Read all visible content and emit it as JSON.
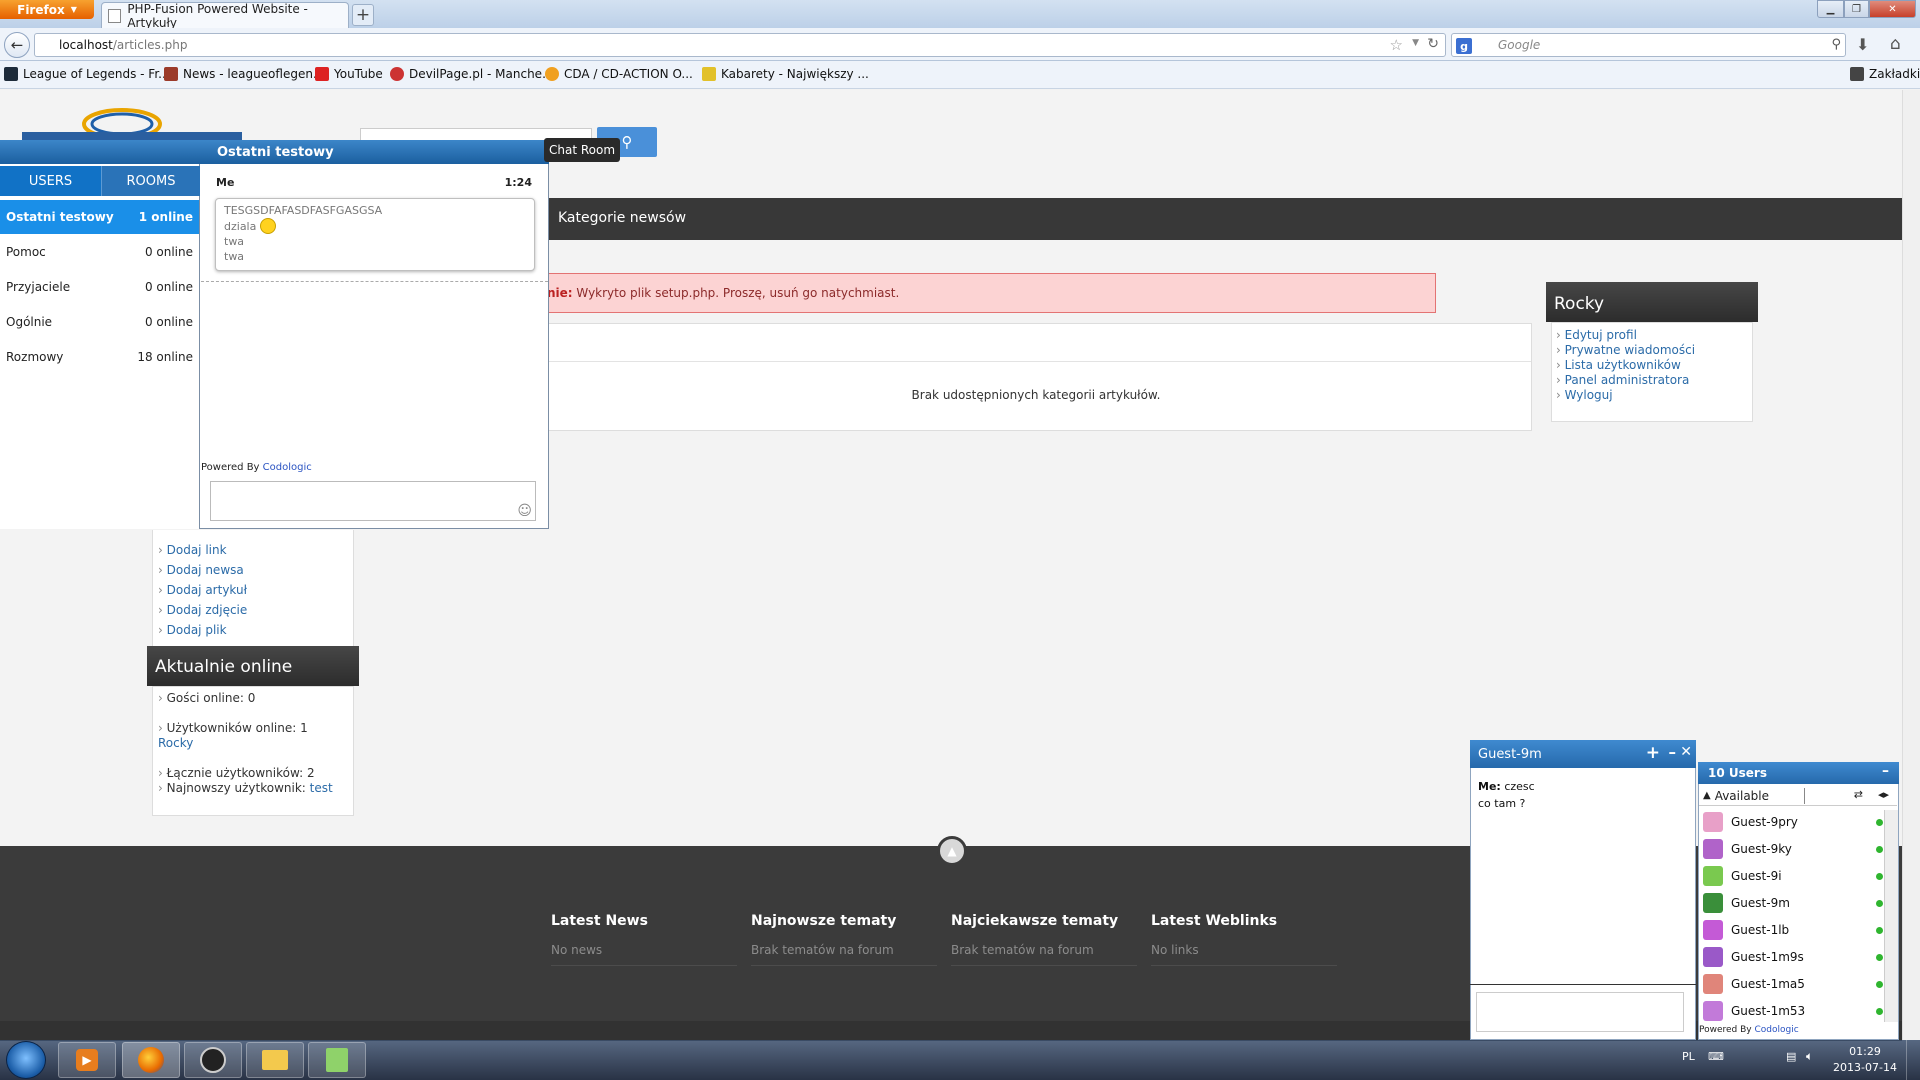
{
  "browser": {
    "app_button": "Firefox",
    "tab_title": "PHP-Fusion Powered Website - Artykuły",
    "url_host": "localhost",
    "url_path": "/articles.php",
    "search_placeholder": "Google",
    "bookmarks": [
      "League of Legends - Fr...",
      "News - leagueoflegen...",
      "YouTube",
      "DevilPage.pl - Manche...",
      "CDA / CD-ACTION O...",
      "Kabarety - Największy ..."
    ],
    "bookmarks_menu": "Zakładki"
  },
  "page": {
    "nav_label": "Kategorie newsów",
    "alert_prefix": "nie:",
    "alert_text": "Wykryto plik setup.php. Proszę, usuń go natychmiast.",
    "content_message": "Brak udostępnionych kategorii artykułów.",
    "user_panel": {
      "title": "Rocky",
      "links": [
        "Edytuj profil",
        "Prywatne wiadomości",
        "Lista użytkowników",
        "Panel administratora",
        "Wyloguj"
      ]
    },
    "submit_links": [
      "Dodaj link",
      "Dodaj newsa",
      "Dodaj artykuł",
      "Dodaj zdjęcie",
      "Dodaj plik"
    ],
    "online_panel": {
      "title": "Aktualnie online",
      "guests": "Gości online: 0",
      "users": "Użytkowników online: 1",
      "user_name": "Rocky",
      "total": "Łącznie użytkowników: 2",
      "newest_label": "Najnowszy użytkownik:",
      "newest_name": "test"
    },
    "footer": [
      {
        "title": "Latest News",
        "value": "No news"
      },
      {
        "title": "Najnowsze tematy",
        "value": "Brak tematów na forum"
      },
      {
        "title": "Najciekawsze tematy",
        "value": "Brak tematów na forum"
      },
      {
        "title": "Latest Weblinks",
        "value": "No links"
      }
    ]
  },
  "chat": {
    "title": "Ostatni testowy",
    "room_tab": "Chat Room",
    "tab_users": "USERS",
    "tab_rooms": "ROOMS",
    "rooms": [
      {
        "name": "Ostatni testowy",
        "count": "1 online"
      },
      {
        "name": "Pomoc",
        "count": "0 online"
      },
      {
        "name": "Przyjaciele",
        "count": "0 online"
      },
      {
        "name": "Ogólnie",
        "count": "0 online"
      },
      {
        "name": "Rozmowy",
        "count": "18 online"
      }
    ],
    "msg_author": "Me",
    "msg_time": "1:24",
    "msg_lines": [
      "TESGSDFAFASDFASFGASGSA",
      "dziala",
      "twa",
      "twa"
    ],
    "powered_by": "Powered By",
    "powered_brand": "Codologic"
  },
  "guest_window": {
    "title": "Guest-9m",
    "msg_author": "Me:",
    "msg_line1": "czesc",
    "msg_line2": "co tam ?"
  },
  "users_list": {
    "title": "10 Users",
    "status": "Available",
    "users": [
      "Guest-9pry",
      "Guest-9ky",
      "Guest-9i",
      "Guest-9m",
      "Guest-1lb",
      "Guest-1m9s",
      "Guest-1ma5",
      "Guest-1m53"
    ],
    "avatar_colors": [
      "#e8a0c8",
      "#b063c9",
      "#7ac94f",
      "#3a8f3a",
      "#c45ad6",
      "#9a59c8",
      "#e0857a",
      "#c27ad9"
    ],
    "powered_by": "Powered By",
    "powered_brand": "Codologic"
  },
  "taskbar": {
    "lang": "PL",
    "time": "01:29",
    "date": "2013-07-14"
  }
}
